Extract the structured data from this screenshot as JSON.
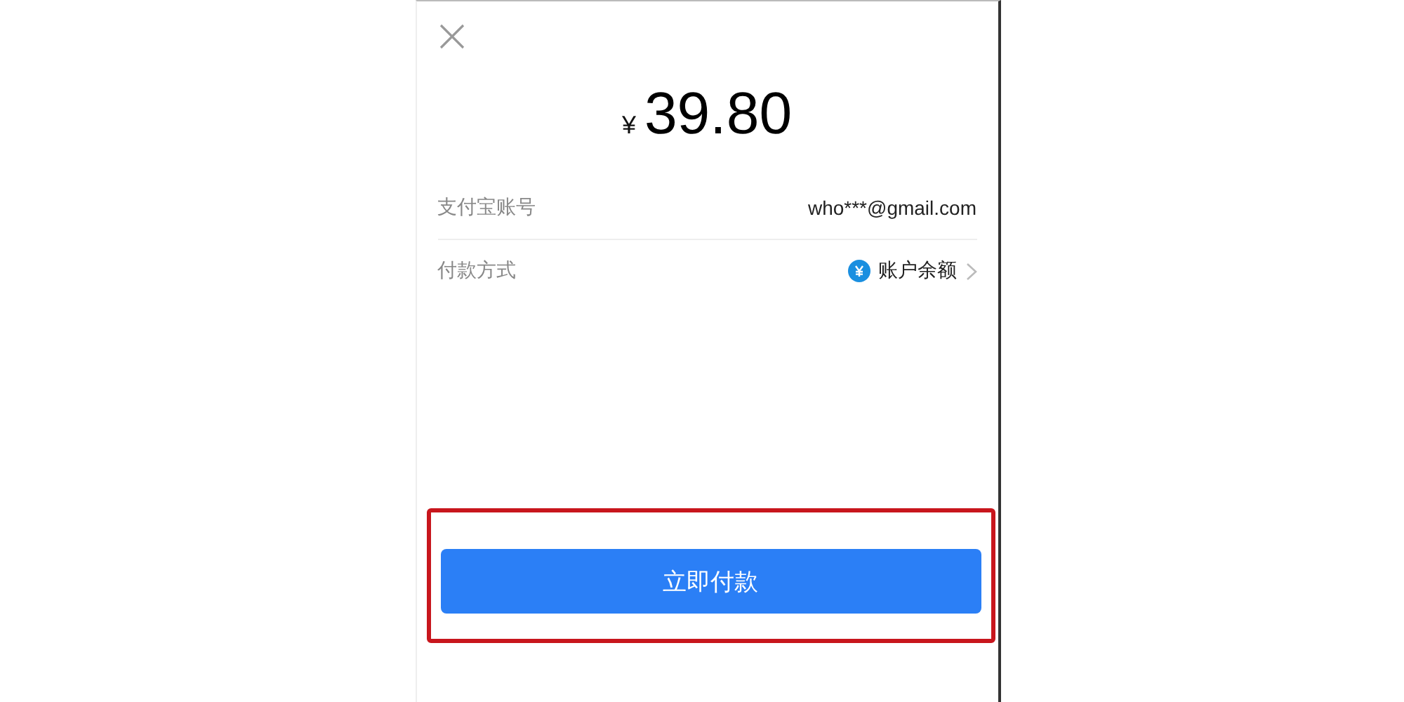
{
  "amount": {
    "currency": "¥",
    "value": "39.80"
  },
  "rows": [
    {
      "kind": "text",
      "label": "支付宝账号",
      "value": "who***@gmail.com"
    },
    {
      "kind": "method",
      "label": "付款方式",
      "value": "账户余额"
    }
  ],
  "button": {
    "label": "立即付款",
    "highlighted": true
  }
}
